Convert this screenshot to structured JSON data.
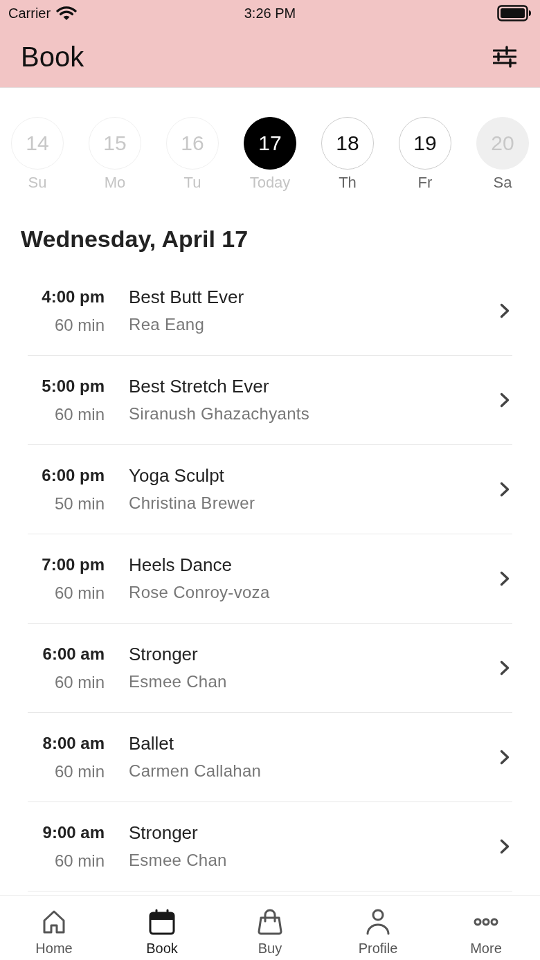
{
  "status_bar": {
    "carrier": "Carrier",
    "time": "3:26 PM"
  },
  "header": {
    "title": "Book"
  },
  "days": [
    {
      "number": "14",
      "label": "Su",
      "kind": "past",
      "selected": false
    },
    {
      "number": "15",
      "label": "Mo",
      "kind": "past",
      "selected": false
    },
    {
      "number": "16",
      "label": "Tu",
      "kind": "past",
      "selected": false
    },
    {
      "number": "17",
      "label": "Today",
      "kind": "today",
      "selected": true
    },
    {
      "number": "18",
      "label": "Th",
      "kind": "open",
      "selected": false
    },
    {
      "number": "19",
      "label": "Fr",
      "kind": "open",
      "selected": false
    },
    {
      "number": "20",
      "label": "Sa",
      "kind": "closed",
      "selected": false
    }
  ],
  "date_heading": "Wednesday, April 17",
  "classes": [
    {
      "time": "4:00 pm",
      "duration": "60 min",
      "title": "Best Butt Ever",
      "instructor": "Rea Eang"
    },
    {
      "time": "5:00 pm",
      "duration": "60 min",
      "title": "Best Stretch Ever",
      "instructor": "Siranush Ghazachyants"
    },
    {
      "time": "6:00 pm",
      "duration": "50 min",
      "title": "Yoga Sculpt",
      "instructor": "Christina Brewer"
    },
    {
      "time": "7:00 pm",
      "duration": "60 min",
      "title": "Heels Dance",
      "instructor": "Rose Conroy-voza"
    },
    {
      "time": "6:00 am",
      "duration": "60 min",
      "title": "Stronger",
      "instructor": "Esmee Chan"
    },
    {
      "time": "8:00 am",
      "duration": "60 min",
      "title": "Ballet",
      "instructor": "Carmen Callahan"
    },
    {
      "time": "9:00 am",
      "duration": "60 min",
      "title": "Stronger",
      "instructor": "Esmee Chan"
    }
  ],
  "tab_bar": [
    {
      "label": "Home",
      "selected": false
    },
    {
      "label": "Book",
      "selected": true
    },
    {
      "label": "Buy",
      "selected": false
    },
    {
      "label": "Profile",
      "selected": false
    },
    {
      "label": "More",
      "selected": false
    }
  ]
}
